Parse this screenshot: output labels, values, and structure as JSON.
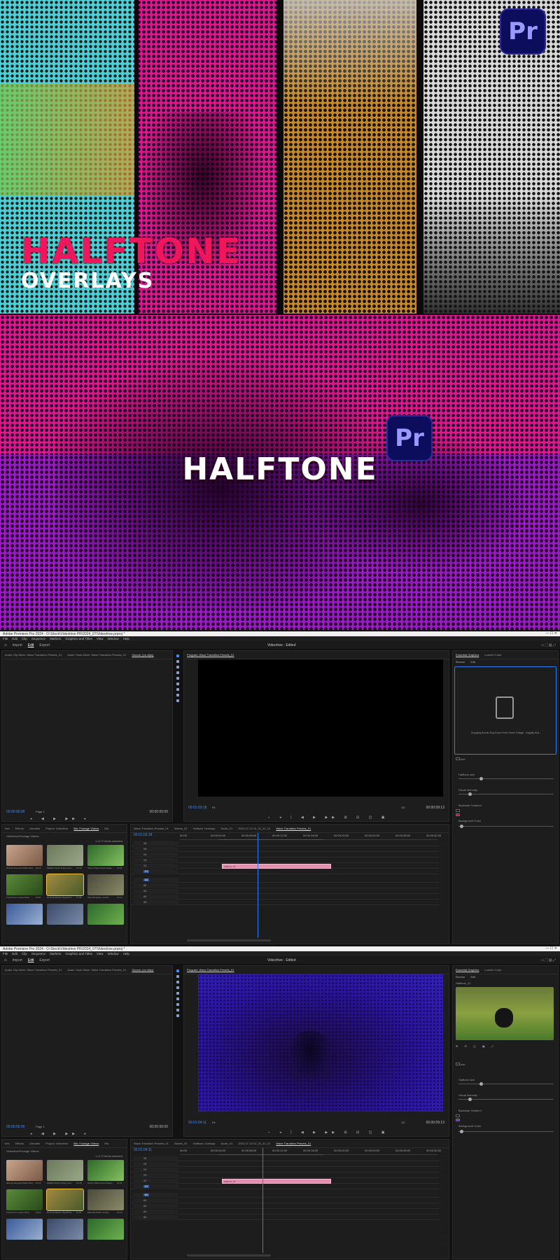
{
  "banner1": {
    "title_line1": "HALFTONE",
    "title_line2": "OVERLAYS",
    "badge": "Pr",
    "colors": {
      "title1": "#f0165e",
      "title2": "#ffffff",
      "accent": "#e0168c"
    }
  },
  "banner2": {
    "title": "HALFTONE",
    "badge": "Pr",
    "colors": {
      "title": "#ffffff",
      "magenta": "#e0168c",
      "purple": "#9a1bd0"
    }
  },
  "screens": [
    {
      "window_title": "Adobe Premiere Pro 2024 - D:\\Stock\\Videohive PR\\2024_07\\Videohive.prproj *",
      "menu": [
        "File",
        "Edit",
        "Clip",
        "Sequence",
        "Markers",
        "Graphics and Titles",
        "View",
        "Window",
        "Help"
      ],
      "nav": {
        "import": "Import",
        "edit": "Edit",
        "export": "Export",
        "project_name": "Videohive - Edited"
      },
      "source_tabs": [
        "Audio Clip Mixer: Wave Transition Presets_01",
        "Audio Track Mixer: Wave Transition Presets_01",
        "Source: (no clips)"
      ],
      "program_title": "Program: Wave Transition Presets_01",
      "program_tc_left": "00:00:00:00",
      "program_tc_mid": "00:01:03:18",
      "program_tc_right": "00:00:09:13",
      "source_tc_left": "00:00:00:00",
      "source_tc_right": "00:00:00:00",
      "fit_label": "Fit",
      "page_label": "Page 1",
      "zoom_label": "1/2",
      "project_tabs": [
        "Info",
        "Effects",
        "Libraries",
        "Project: Videohive",
        "Bin: Footage Videos",
        "His"
      ],
      "project_path": "Videohive/Footage Videos",
      "project_count": "1 of 17 items selected",
      "thumbs": [
        {
          "cap": "Woman Dressed White Dres...",
          "dur": "10:12"
        },
        {
          "cap": "Mallard Ducks Flying Over...",
          "dur": "13:18"
        },
        {
          "cap": "Green Plants Grow Wings...",
          "dur": "14:01"
        },
        {
          "cap": "Fresh Fern Leaves Dark...",
          "dur": "10:01"
        },
        {
          "cap": "Running Border Dog Runs...",
          "dur": "11:03"
        },
        {
          "cap": "Plant Mountain Landsc...",
          "dur": "10:14"
        },
        {
          "cap": "",
          "dur": ""
        },
        {
          "cap": "",
          "dur": ""
        },
        {
          "cap": "",
          "dur": ""
        }
      ],
      "timeline_tabs": [
        "Wave Transition Presets_01",
        "Waves_01",
        "Halftone Overlays",
        "Audio_01",
        "2024-07-10 10_31_42_01",
        "Wave Transition Presets_01"
      ],
      "timeline_tc": "00:01:03:18",
      "ruler": [
        "00:00",
        "00:00:04:00",
        "00:00:08:00",
        "00:00:12:00",
        "00:00:16:00",
        "00:00:20:00",
        "00:00:24:00",
        "00:00:28:00",
        "00:00:32:00"
      ],
      "tracks": [
        "V6",
        "V5",
        "V4",
        "V3",
        "V2",
        "V1",
        "A1",
        "A2",
        "A3",
        "A4",
        "A5"
      ],
      "clip_label": "Halftone_01",
      "eg_tabs": [
        "Essential Graphics",
        "Lumetri Color"
      ],
      "eg_subtabs": [
        "Browse",
        "Edit"
      ],
      "eg_drop_text": "Dropping Border Dog Runs Fresh Green Foliage - Brightly Suit...",
      "eg_props": [
        "Color",
        "Halftone size",
        "Visual Intensity",
        "Backside Gradient",
        "Background Color"
      ],
      "color_swatch": "#1a1a1a",
      "color_red": "#d01818"
    },
    {
      "window_title": "Adobe Premiere Pro 2024 - D:\\Stock\\Videohive PR\\2024_07\\Videohive.prproj *",
      "menu": [
        "File",
        "Edit",
        "Clip",
        "Sequence",
        "Markers",
        "Graphics and Titles",
        "View",
        "Window",
        "Help"
      ],
      "nav": {
        "import": "Import",
        "edit": "Edit",
        "export": "Export",
        "project_name": "Videohive - Edited"
      },
      "source_tabs": [
        "Audio Clip Mixer: Wave Transition Presets_01",
        "Audio Track Mixer: Wave Transition Presets_01",
        "Source: (no clips)"
      ],
      "program_title": "Program: Wave Transition Presets_01",
      "program_tc_left": "00:00:00:00",
      "program_tc_mid": "00:01:04:11",
      "program_tc_right": "00:00:09:13",
      "source_tc_left": "00:00:00:00",
      "source_tc_right": "00:00:00:00",
      "fit_label": "Fit",
      "page_label": "Page 1",
      "zoom_label": "1/2",
      "project_tabs": [
        "Info",
        "Effects",
        "Libraries",
        "Project: Videohive",
        "Bin: Footage Videos",
        "His"
      ],
      "project_path": "Videohive/Footage Videos",
      "project_count": "1 of 17 items selected",
      "thumbs": [
        {
          "cap": "Woman Dressed White Dres...",
          "dur": "10:12"
        },
        {
          "cap": "Mallard Ducks Flying Over...",
          "dur": "13:18"
        },
        {
          "cap": "Green Plants Grow Wings...",
          "dur": "14:01"
        },
        {
          "cap": "Fresh Fern Leaves Dark...",
          "dur": "10:01"
        },
        {
          "cap": "Running Border Dog Runs...",
          "dur": "11:03"
        },
        {
          "cap": "Plant Mountain Landsc...",
          "dur": "10:14"
        },
        {
          "cap": "",
          "dur": ""
        },
        {
          "cap": "",
          "dur": ""
        },
        {
          "cap": "",
          "dur": ""
        }
      ],
      "timeline_tabs": [
        "Wave Transition Presets_01",
        "Waves_01",
        "Halftone Overlays",
        "Audio_01",
        "2024-07-10 10_31_42_01",
        "Wave Transition Presets_01"
      ],
      "timeline_tc": "00:01:04:11",
      "ruler": [
        "00:00",
        "00:00:04:00",
        "00:00:08:00",
        "00:00:12:00",
        "00:00:16:00",
        "00:00:20:00",
        "00:00:24:00",
        "00:00:28:00",
        "00:00:32:00"
      ],
      "tracks": [
        "V6",
        "V5",
        "V4",
        "V3",
        "V2",
        "V1",
        "A1",
        "A2",
        "A3",
        "A4",
        "A5"
      ],
      "clip_label": "Halftone_01",
      "eg_tabs": [
        "Essential Graphics",
        "Lumetri Color"
      ],
      "eg_subtabs": [
        "Browse",
        "Edit"
      ],
      "eg_drop_text": "Halftone_01",
      "eg_props": [
        "Color",
        "Halftone size",
        "Visual Intensity",
        "Backside Gradient",
        "Background Color"
      ],
      "color_swatch": "#1a1a1a",
      "color_red": "#7a2ad8"
    }
  ]
}
